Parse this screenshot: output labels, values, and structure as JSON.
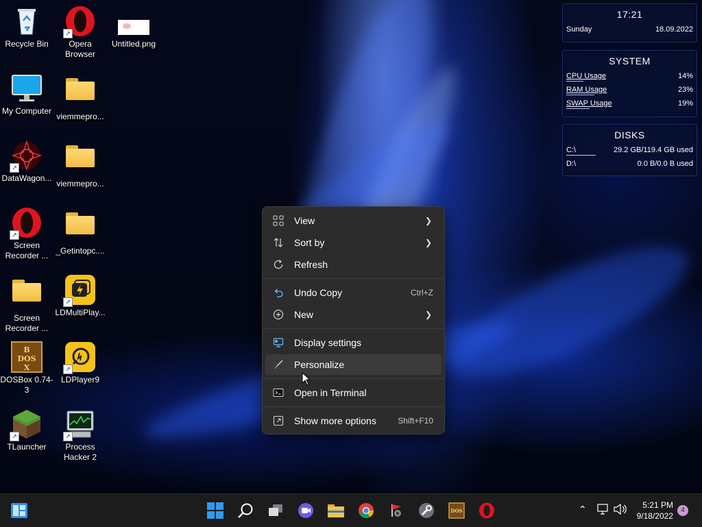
{
  "desktop_icons": [
    {
      "label": "Recycle Bin",
      "icon": "recycle-bin-icon"
    },
    {
      "label": "Opera Browser",
      "icon": "opera-icon",
      "shortcut": true
    },
    {
      "label": "Untitled.png",
      "icon": "image-file-icon"
    },
    {
      "label": "My Computer",
      "icon": "monitor-icon"
    },
    {
      "label": "viemmepro...",
      "icon": "folder-icon"
    },
    {
      "label": "DataWagon...",
      "icon": "datawagon-icon",
      "shortcut": true
    },
    {
      "label": "viemmepro...",
      "icon": "folder-icon"
    },
    {
      "label": "Screen Recorder ...",
      "icon": "opera-icon",
      "shortcut": true
    },
    {
      "label": "_Getintopc....",
      "icon": "folder-icon"
    },
    {
      "label": "Screen Recorder ...",
      "icon": "folder-icon"
    },
    {
      "label": "LDMultiPlay...",
      "icon": "ldmultiplayer-icon",
      "shortcut": true
    },
    {
      "label": "DOSBox 0.74-3",
      "icon": "dosbox-icon"
    },
    {
      "label": "LDPlayer9",
      "icon": "ldplayer-icon",
      "shortcut": true
    },
    {
      "label": "TLauncher",
      "icon": "minecraft-block-icon",
      "shortcut": true
    },
    {
      "label": "Process Hacker 2",
      "icon": "process-hacker-icon",
      "shortcut": true
    }
  ],
  "gadgets": {
    "clock": {
      "time": "17:21",
      "day": "Sunday",
      "date": "18.09.2022"
    },
    "system": {
      "title": "SYSTEM",
      "rows": [
        {
          "label": "CPU Usage",
          "value": "14%",
          "percent": 14
        },
        {
          "label": "RAM Usage",
          "value": "23%",
          "percent": 23
        },
        {
          "label": "SWAP Usage",
          "value": "19%",
          "percent": 19
        }
      ]
    },
    "disks": {
      "title": "DISKS",
      "rows": [
        {
          "label": "C:\\",
          "value": "29.2 GB/119.4 GB used",
          "percent": 24
        },
        {
          "label": "D:\\",
          "value": "0.0 B/0.0 B used",
          "percent": 0
        }
      ]
    }
  },
  "context_menu": {
    "items": [
      {
        "label": "View",
        "icon": "grid-view-icon",
        "submenu": true
      },
      {
        "label": "Sort by",
        "icon": "sort-icon",
        "submenu": true
      },
      {
        "label": "Refresh",
        "icon": "refresh-icon"
      },
      {
        "label": "Undo Copy",
        "icon": "undo-icon",
        "shortcut": "Ctrl+Z"
      },
      {
        "label": "New",
        "icon": "plus-circle-icon",
        "submenu": true
      },
      {
        "label": "Display settings",
        "icon": "display-settings-icon"
      },
      {
        "label": "Personalize",
        "icon": "brush-icon",
        "highlighted": true
      },
      {
        "label": "Open in Terminal",
        "icon": "terminal-icon"
      },
      {
        "label": "Show more options",
        "icon": "more-options-icon",
        "shortcut": "Shift+F10"
      }
    ]
  },
  "taskbar": {
    "pinned": [
      {
        "name": "start",
        "icon": "windows-start-icon"
      },
      {
        "name": "search",
        "icon": "search-icon"
      },
      {
        "name": "task-view",
        "icon": "task-view-icon"
      },
      {
        "name": "teams-chat",
        "icon": "chat-camera-icon"
      },
      {
        "name": "file-explorer",
        "icon": "folder-icon"
      },
      {
        "name": "chrome",
        "icon": "chrome-icon"
      },
      {
        "name": "app-red-flag",
        "icon": "red-flag-app-icon"
      },
      {
        "name": "app-tools",
        "icon": "tools-app-icon"
      },
      {
        "name": "dosbox",
        "icon": "dosbox-icon"
      },
      {
        "name": "opera",
        "icon": "opera-icon"
      }
    ],
    "time": "5:21 PM",
    "date": "9/18/2022",
    "notification_count": "4"
  },
  "colors": {
    "menu_bg": "#2c2c2c",
    "taskbar_bg": "#1c1c1c",
    "accent": "#1e78d6"
  }
}
